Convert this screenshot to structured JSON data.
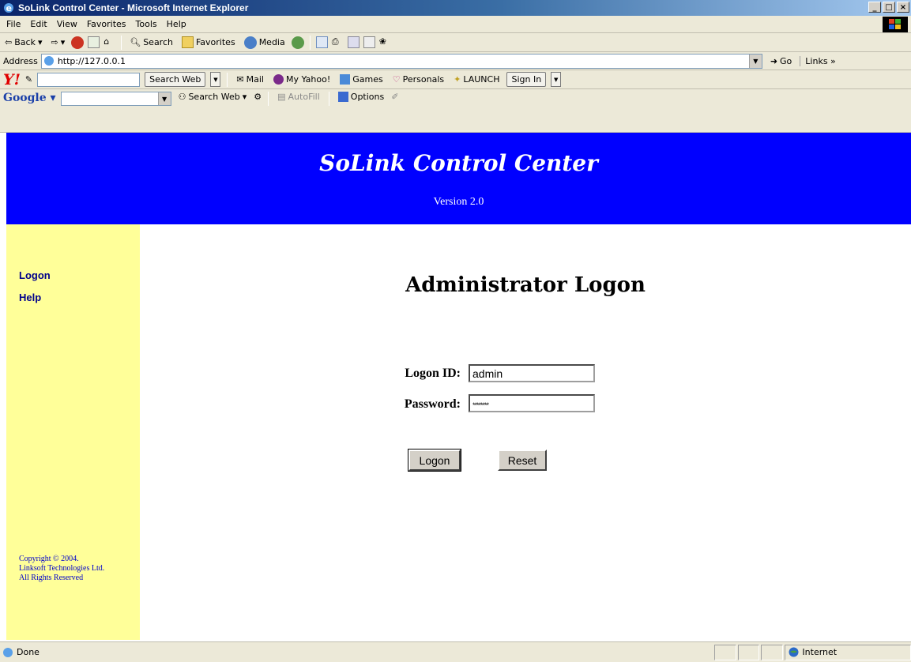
{
  "window": {
    "title": "SoLink Control Center - Microsoft Internet Explorer",
    "controls": {
      "minimize": "_",
      "maximize": "□",
      "close": "×"
    }
  },
  "menu": [
    "File",
    "Edit",
    "View",
    "Favorites",
    "Tools",
    "Help"
  ],
  "toolbar": {
    "back": "Back",
    "search": "Search",
    "favorites": "Favorites",
    "media": "Media"
  },
  "address_bar": {
    "label": "Address",
    "url": "http://127.0.0.1",
    "go": "Go",
    "links": "Links"
  },
  "yahoo_bar": {
    "logo": "Y!",
    "search_button": "Search Web",
    "mail": "Mail",
    "my_yahoo": "My Yahoo!",
    "games": "Games",
    "personals": "Personals",
    "launch": "LAUNCH",
    "sign_in": "Sign In"
  },
  "google_bar": {
    "logo": "Google",
    "search_button": "Search Web",
    "autofill": "AutoFill",
    "options": "Options"
  },
  "page": {
    "title": "SoLink Control Center",
    "version": "Version 2.0",
    "sidebar": {
      "links": [
        "Logon",
        "Help"
      ],
      "copyright": [
        "Copyright © 2004.",
        "Linksoft Technologies Ltd.",
        "All Rights Reserved"
      ]
    },
    "heading": "Administrator Logon",
    "form": {
      "logon_id_label": "Logon ID:",
      "logon_id_value": "admin",
      "password_label": "Password:",
      "password_value": "********",
      "logon_button": "Logon",
      "reset_button": "Reset"
    }
  },
  "status": {
    "text": "Done",
    "zone": "Internet"
  }
}
